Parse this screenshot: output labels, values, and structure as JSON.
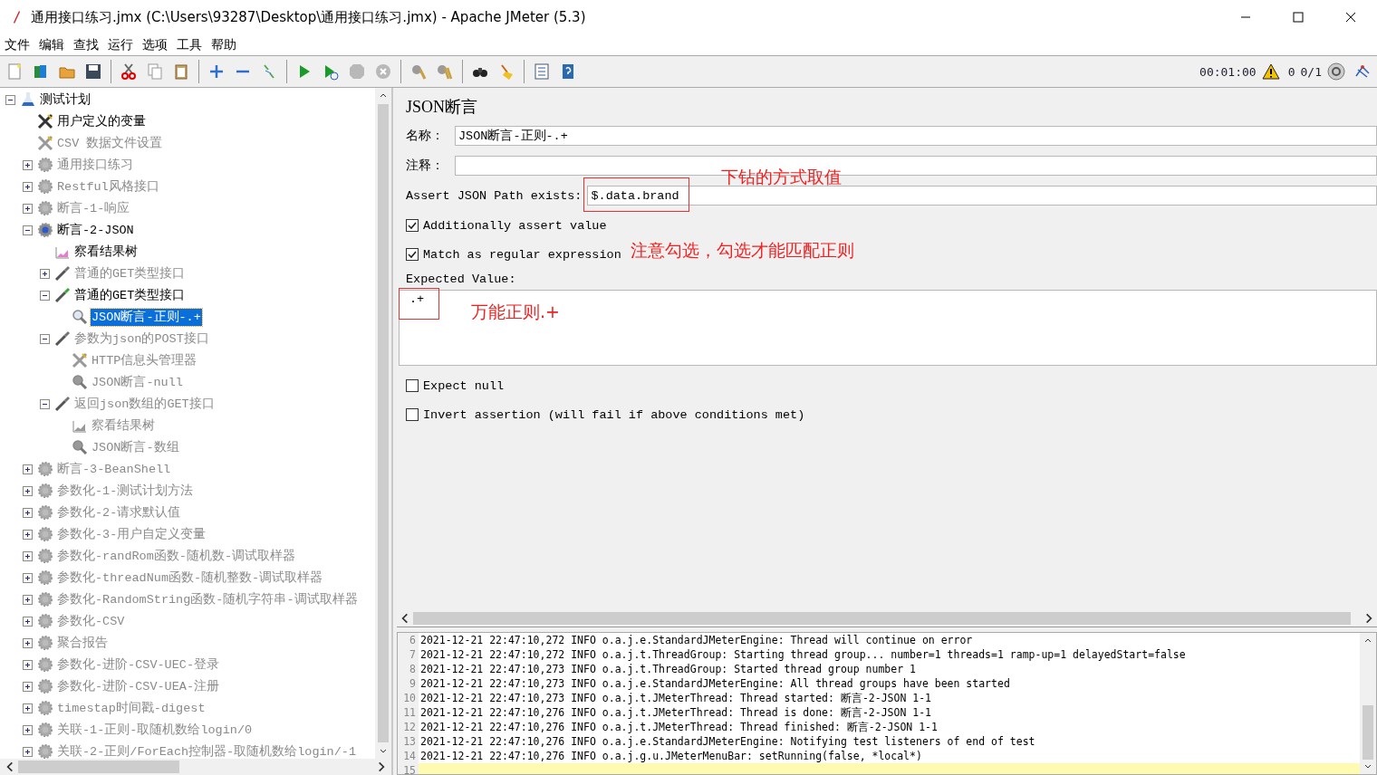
{
  "window": {
    "title": "通用接口练习.jmx (C:\\Users\\93287\\Desktop\\通用接口练习.jmx) - Apache JMeter (5.3)"
  },
  "menu": [
    "文件",
    "编辑",
    "查找",
    "运行",
    "选项",
    "工具",
    "帮助"
  ],
  "status": {
    "timer": "00:01:00",
    "warnings": "0",
    "threads": "0/1"
  },
  "tree": [
    {
      "label": "测试计划",
      "kind": "plan",
      "expanded": true,
      "disabled": false,
      "selected": false,
      "children": [
        {
          "label": "用户定义的变量",
          "kind": "tools",
          "disabled": false,
          "selected": false
        },
        {
          "label": "CSV 数据文件设置",
          "kind": "tools",
          "disabled": true,
          "selected": false
        },
        {
          "label": "通用接口练习",
          "kind": "gear",
          "expanded": false,
          "disabled": true,
          "selected": false
        },
        {
          "label": "Restful风格接口",
          "kind": "gear",
          "expanded": false,
          "disabled": true,
          "selected": false
        },
        {
          "label": "断言-1-响应",
          "kind": "gear",
          "expanded": false,
          "disabled": true,
          "selected": false
        },
        {
          "label": "断言-2-JSON",
          "kind": "gear",
          "expanded": true,
          "disabled": false,
          "selected": false,
          "children": [
            {
              "label": "察看结果树",
              "kind": "listener",
              "disabled": false,
              "selected": false
            },
            {
              "label": "普通的GET类型接口",
              "kind": "sampler",
              "expanded": false,
              "disabled": true,
              "selected": false
            },
            {
              "label": "普通的GET类型接口",
              "kind": "sampler",
              "expanded": true,
              "disabled": false,
              "selected": false,
              "children": [
                {
                  "label": "JSON断言-正则-.+",
                  "kind": "assertion",
                  "disabled": false,
                  "selected": true
                }
              ]
            },
            {
              "label": "参数为json的POST接口",
              "kind": "sampler",
              "expanded": true,
              "disabled": true,
              "selected": false,
              "children": [
                {
                  "label": "HTTP信息头管理器",
                  "kind": "tools",
                  "disabled": true,
                  "selected": false
                },
                {
                  "label": "JSON断言-null",
                  "kind": "assertion",
                  "disabled": true,
                  "selected": false
                }
              ]
            },
            {
              "label": "返回json数组的GET接口",
              "kind": "sampler",
              "expanded": true,
              "disabled": true,
              "selected": false,
              "children": [
                {
                  "label": "察看结果树",
                  "kind": "listener",
                  "disabled": true,
                  "selected": false
                },
                {
                  "label": "JSON断言-数组",
                  "kind": "assertion",
                  "disabled": true,
                  "selected": false
                }
              ]
            }
          ]
        },
        {
          "label": "断言-3-BeanShell",
          "kind": "gear",
          "expanded": false,
          "disabled": true,
          "selected": false
        },
        {
          "label": "参数化-1-测试计划方法",
          "kind": "gear",
          "expanded": false,
          "disabled": true,
          "selected": false
        },
        {
          "label": "参数化-2-请求默认值",
          "kind": "gear",
          "expanded": false,
          "disabled": true,
          "selected": false
        },
        {
          "label": "参数化-3-用户自定义变量",
          "kind": "gear",
          "expanded": false,
          "disabled": true,
          "selected": false
        },
        {
          "label": "参数化-randRom函数-随机数-调试取样器",
          "kind": "gear",
          "expanded": false,
          "disabled": true,
          "selected": false
        },
        {
          "label": "参数化-threadNum函数-随机整数-调试取样器",
          "kind": "gear",
          "expanded": false,
          "disabled": true,
          "selected": false
        },
        {
          "label": "参数化-RandomString函数-随机字符串-调试取样器",
          "kind": "gear",
          "expanded": false,
          "disabled": true,
          "selected": false
        },
        {
          "label": "参数化-CSV",
          "kind": "gear",
          "expanded": false,
          "disabled": true,
          "selected": false
        },
        {
          "label": "聚合报告",
          "kind": "gear",
          "expanded": false,
          "disabled": true,
          "selected": false
        },
        {
          "label": "参数化-进阶-CSV-UEC-登录",
          "kind": "gear",
          "expanded": false,
          "disabled": true,
          "selected": false
        },
        {
          "label": "参数化-进阶-CSV-UEA-注册",
          "kind": "gear",
          "expanded": false,
          "disabled": true,
          "selected": false
        },
        {
          "label": "timestap时间戳-digest",
          "kind": "gear",
          "expanded": false,
          "disabled": true,
          "selected": false
        },
        {
          "label": "关联-1-正则-取随机数给login/0",
          "kind": "gear",
          "expanded": false,
          "disabled": true,
          "selected": false
        },
        {
          "label": "关联-2-正则/ForEach控制器-取随机数给login/-1",
          "kind": "gear",
          "expanded": false,
          "disabled": true,
          "selected": false
        }
      ]
    }
  ],
  "editor": {
    "title": "JSON断言",
    "name_label": "名称：",
    "name_value": "JSON断言-正则-.+",
    "comment_label": "注释：",
    "path_label": "Assert JSON Path exists:",
    "path_value": "$.data.brand",
    "path_highlighted": true,
    "path_note": "下钻的方式取值",
    "checkboxes": [
      {
        "label": "Additionally assert value",
        "checked": true
      },
      {
        "label": "Match as regular expression",
        "checked": true,
        "note": "注意勾选，勾选才能匹配正则"
      }
    ],
    "expected_label": "Expected Value:",
    "expected_value": ".+",
    "expected_highlighted": true,
    "expected_note": "万能正则.+",
    "options": [
      {
        "label": "Expect null",
        "checked": false
      },
      {
        "label": "Invert assertion (will fail if above conditions met)",
        "checked": false
      }
    ]
  },
  "log": [
    {
      "number": "6",
      "text": "2021-12-21 22:47:10,272 INFO o.a.j.e.StandardJMeterEngine: Thread will continue on error",
      "current": false
    },
    {
      "number": "7",
      "text": "2021-12-21 22:47:10,272 INFO o.a.j.t.ThreadGroup: Starting thread group... number=1 threads=1 ramp-up=1 delayedStart=false",
      "current": false
    },
    {
      "number": "8",
      "text": "2021-12-21 22:47:10,273 INFO o.a.j.t.ThreadGroup: Started thread group number 1",
      "current": false
    },
    {
      "number": "9",
      "text": "2021-12-21 22:47:10,273 INFO o.a.j.e.StandardJMeterEngine: All thread groups have been started",
      "current": false
    },
    {
      "number": "10",
      "text": "2021-12-21 22:47:10,273 INFO o.a.j.t.JMeterThread: Thread started: 断言-2-JSON 1-1",
      "current": false
    },
    {
      "number": "11",
      "text": "2021-12-21 22:47:10,276 INFO o.a.j.t.JMeterThread: Thread is done: 断言-2-JSON 1-1",
      "current": false
    },
    {
      "number": "12",
      "text": "2021-12-21 22:47:10,276 INFO o.a.j.t.JMeterThread: Thread finished: 断言-2-JSON 1-1",
      "current": false
    },
    {
      "number": "13",
      "text": "2021-12-21 22:47:10,276 INFO o.a.j.e.StandardJMeterEngine: Notifying test listeners of end of test",
      "current": false
    },
    {
      "number": "14",
      "text": "2021-12-21 22:47:10,276 INFO o.a.j.g.u.JMeterMenuBar: setRunning(false, *local*)",
      "current": false
    },
    {
      "number": "15",
      "current": true
    }
  ]
}
